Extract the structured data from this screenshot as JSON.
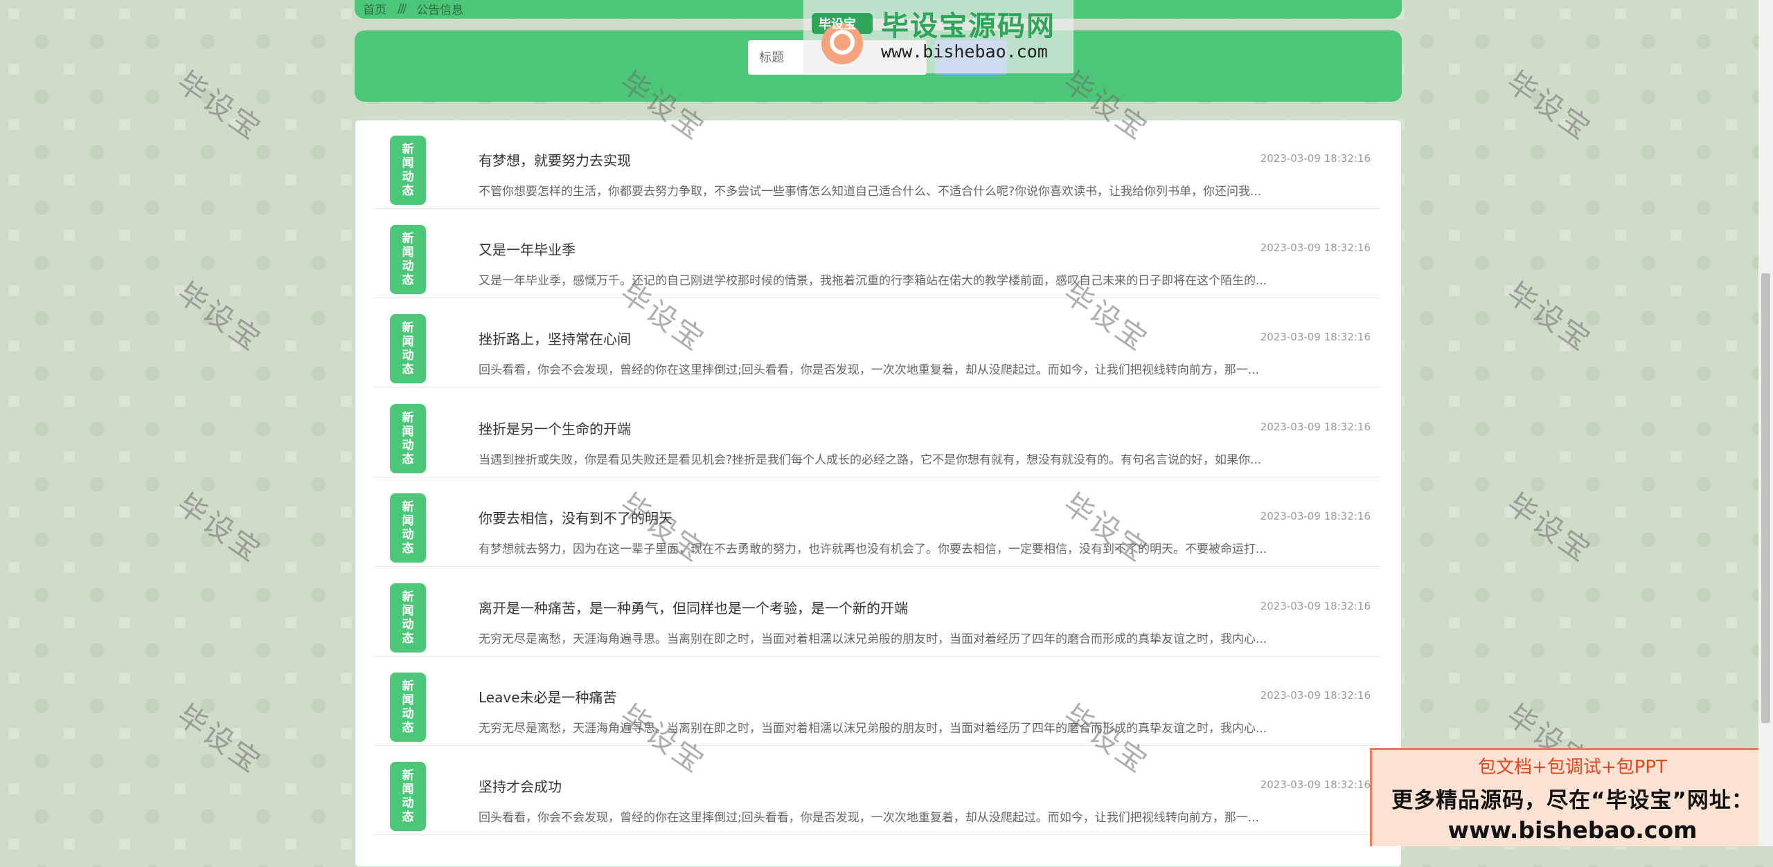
{
  "breadcrumb": {
    "home": "首页",
    "separator": "///",
    "current": "公告信息"
  },
  "search": {
    "placeholder": "标题",
    "button_label": ""
  },
  "badge_text": "新闻动态",
  "news": [
    {
      "title": "有梦想，就要努力去实现",
      "date": "2023-03-09 18:32:16",
      "summary": "不管你想要怎样的生活，你都要去努力争取，不多尝试一些事情怎么知道自己适合什么、不适合什么呢?你说你喜欢读书，让我给你列书单，你还问我..."
    },
    {
      "title": "又是一年毕业季",
      "date": "2023-03-09 18:32:16",
      "summary": "又是一年毕业季，感慨万千。还记的自己刚进学校那时候的情景，我拖着沉重的行李箱站在偌大的教学楼前面，感叹自己未来的日子即将在这个陌生的..."
    },
    {
      "title": "挫折路上，坚持常在心间",
      "date": "2023-03-09 18:32:16",
      "summary": "回头看看，你会不会发现，曾经的你在这里摔倒过;回头看看，你是否发现，一次次地重复着，却从没爬起过。而如今，让我们把视线转向前方，那一..."
    },
    {
      "title": "挫折是另一个生命的开端",
      "date": "2023-03-09 18:32:16",
      "summary": "当遇到挫折或失败，你是看见失败还是看见机会?挫折是我们每个人成长的必经之路，它不是你想有就有，想没有就没有的。有句名言说的好，如果你..."
    },
    {
      "title": "你要去相信，没有到不了的明天",
      "date": "2023-03-09 18:32:16",
      "summary": "有梦想就去努力，因为在这一辈子里面，现在不去勇敢的努力，也许就再也没有机会了。你要去相信，一定要相信，没有到不了的明天。不要被命运打..."
    },
    {
      "title": "离开是一种痛苦，是一种勇气，但同样也是一个考验，是一个新的开端",
      "date": "2023-03-09 18:32:16",
      "summary": "无穷无尽是离愁，天涯海角遍寻思。当离别在即之时，当面对着相濡以沫兄弟般的朋友时，当面对着经历了四年的磨合而形成的真挚友谊之时，我内心..."
    },
    {
      "title": "Leave未必是一种痛苦",
      "date": "2023-03-09 18:32:16",
      "summary": "无穷无尽是离愁，天涯海角遍寻思。当离别在即之时，当面对着相濡以沫兄弟般的朋友时，当面对着经历了四年的磨合而形成的真挚友谊之时，我内心..."
    },
    {
      "title": "坚持才会成功",
      "date": "2023-03-09 18:32:16",
      "summary": "回头看看，你会不会发现，曾经的你在这里摔倒过;回头看看，你是否发现，一次次地重复着，却从没爬起过。而如今，让我们把视线转向前方，那一..."
    }
  ],
  "watermark_text": "毕设宝",
  "logo": {
    "badge": "毕设宝",
    "name": "毕设宝源码网",
    "url": "www.bishebao.com"
  },
  "promo": {
    "line1": "包文档+包调试+包PPT",
    "line2": "更多精品源码，尽在“毕设宝”网址：",
    "line3": "www.bishebao.com"
  },
  "colors": {
    "accent": "#4cc777",
    "search_button": "#8ab6f3",
    "promo_red": "#e6461e"
  }
}
